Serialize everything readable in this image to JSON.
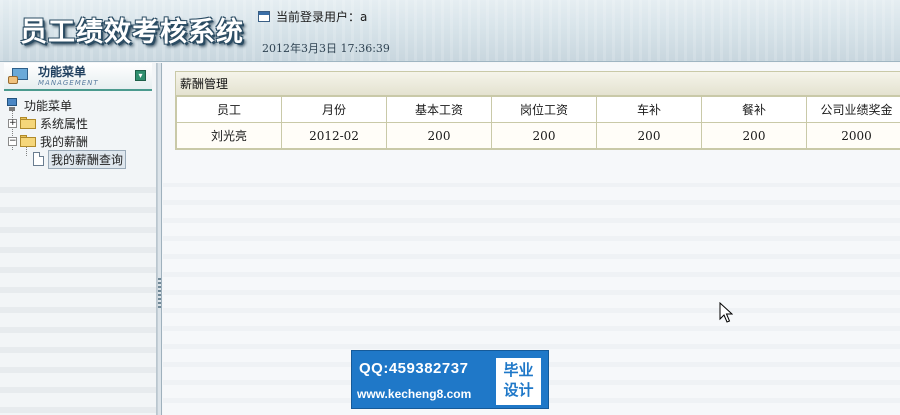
{
  "header": {
    "app_title": "员工绩效考核系统",
    "login_label": "当前登录用户：a",
    "datetime": "2012年3月3日  17:36:39"
  },
  "sidebar": {
    "title": "功能菜单",
    "subtitle": "MANAGEMENT",
    "tree": {
      "root": "功能菜单",
      "items": [
        {
          "label": "系统属性",
          "expander": "+"
        },
        {
          "label": "我的薪酬",
          "expander": "−"
        },
        {
          "label": "我的薪酬查询"
        }
      ]
    }
  },
  "main": {
    "panel_title": "薪酬管理",
    "columns": [
      "员工",
      "月份",
      "基本工资",
      "岗位工资",
      "车补",
      "餐补",
      "公司业绩奖金"
    ],
    "rows": [
      [
        "刘光亮",
        "2012-02",
        "200",
        "200",
        "200",
        "200",
        "2000"
      ]
    ]
  },
  "watermark": {
    "qq": "QQ:459382737",
    "url": "www.kecheng8.com",
    "badge_line1": "毕业",
    "badge_line2": "设计"
  },
  "icons": {
    "window": "window-icon",
    "menu": "menu-icon",
    "collapse": "collapse-icon",
    "root": "computer-icon",
    "folder": "folder-icon",
    "document": "document-icon",
    "cursor": "mouse-cursor-icon"
  },
  "colors": {
    "header_text": "#ffffff",
    "header_outline": "#2b4c63",
    "sidebar_accent": "#4b9a8e",
    "table_border": "#c9c9a8",
    "watermark_bg": "#1f78c8"
  }
}
